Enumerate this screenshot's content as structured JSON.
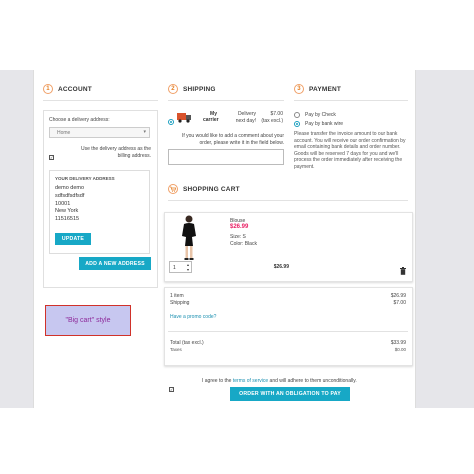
{
  "account": {
    "num": "1",
    "title": "ACCOUNT",
    "choose_label": "Choose a delivery address:",
    "select_value": "Home",
    "same_billing": "Use the delivery address as the billing address.",
    "address_heading": "YOUR DELIVERY ADDRESS",
    "address_lines": [
      "demo demo",
      "sdfsdfsdfsdf",
      "10001",
      "New York",
      "11516515"
    ],
    "update_label": "UPDATE",
    "add_address_label": "ADD A NEW ADDRESS"
  },
  "shipping": {
    "num": "2",
    "title": "SHIPPING",
    "carrier_name": "My carrier",
    "carrier_delay": "Delivery next day!",
    "carrier_price": "$7.00",
    "carrier_tax": "(tax excl.)",
    "comment_prompt": "If you would like to add a comment about your order, please write it in the field below."
  },
  "payment": {
    "num": "3",
    "title": "PAYMENT",
    "options": [
      "Pay by Check",
      "Pay by bank wire"
    ],
    "selected_index": 1,
    "description": "Please transfer the invoice amount to our bank account. You will receive our order confirmation by email containing bank details and order number. Goods will be reserved 7 days for you and we'll process the order immediately after receiving the payment."
  },
  "cart": {
    "title": "SHOPPING CART",
    "product": {
      "name": "Blouse",
      "price": "$26.99",
      "size": "Size: S",
      "color": "Color: Black",
      "qty": "1",
      "line_total": "$26.99"
    },
    "totals": {
      "items_label": "1 item",
      "items_value": "$26.99",
      "shipping_label": "Shipping",
      "shipping_value": "$7.00",
      "promo_link": "Have a promo code?",
      "total_label": "Total (tax excl.)",
      "total_value": "$33.99",
      "taxes_label": "Taxes",
      "taxes_value": "$0.00"
    }
  },
  "terms": {
    "prefix": "I agree to the ",
    "link": "terms of service",
    "suffix": " and will adhere to them unconditionally."
  },
  "order_button": "ORDER WITH AN OBLIGATION TO PAY",
  "style_badge": "\"Big cart\" style",
  "colors": {
    "accent": "#17a8c6",
    "step": "#e67e22",
    "price": "#e91e63",
    "badge_bg": "#c7c7f0",
    "badge_border": "#d0322a"
  }
}
